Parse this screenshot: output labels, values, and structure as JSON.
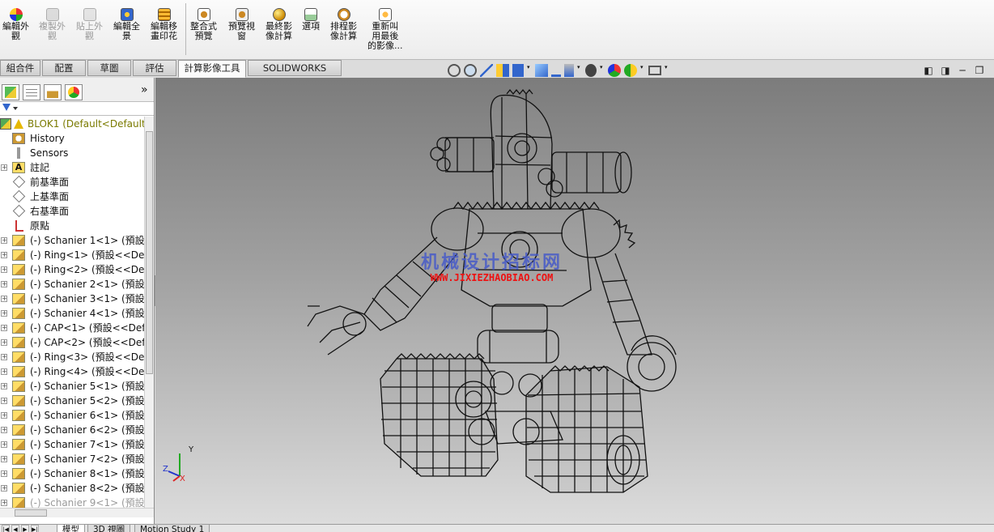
{
  "ribbon": {
    "buttons": [
      {
        "label": "編輯外\n觀",
        "icon": "edit-appearance-icon",
        "enabled": true
      },
      {
        "label": "複製外\n觀",
        "icon": "copy-appearance-icon",
        "enabled": false
      },
      {
        "label": "貼上外\n觀",
        "icon": "paste-appearance-icon",
        "enabled": false
      },
      {
        "label": "編輯全\n景",
        "icon": "edit-scene-icon",
        "enabled": true
      },
      {
        "label": "編輯移\n畫印花",
        "icon": "edit-decal-icon",
        "enabled": true
      },
      {
        "label": "整合式\n預覽",
        "icon": "integrated-preview-icon",
        "enabled": true
      },
      {
        "label": "預覽視\n窗",
        "icon": "preview-window-icon",
        "enabled": true
      },
      {
        "label": "最終影\n像計算",
        "icon": "final-render-icon",
        "enabled": true
      },
      {
        "label": "選項",
        "icon": "options-icon",
        "enabled": true
      },
      {
        "label": "排程影\n像計算",
        "icon": "schedule-render-icon",
        "enabled": true
      },
      {
        "label": "重新叫\n用最後\n的影像...",
        "icon": "recall-last-image-icon",
        "enabled": true
      }
    ]
  },
  "tabs": [
    "組合件",
    "配置",
    "草圖",
    "評估",
    "計算影像工具",
    "SOLIDWORKS MBD"
  ],
  "active_tab": "計算影像工具",
  "panel": {
    "more": "»",
    "filter_icon": "filter-icon"
  },
  "tree": [
    {
      "label": "BLOK1  (Default<Default_",
      "icon": "assembly-icon",
      "expand": "minus",
      "root": true
    },
    {
      "label": "History",
      "icon": "history-icon",
      "expand": ""
    },
    {
      "label": "Sensors",
      "icon": "sensors-icon",
      "expand": ""
    },
    {
      "label": "註記",
      "icon": "annotations-icon",
      "expand": "plus"
    },
    {
      "label": "前基準面",
      "icon": "plane-icon",
      "expand": ""
    },
    {
      "label": "上基準面",
      "icon": "plane-icon",
      "expand": ""
    },
    {
      "label": "右基準面",
      "icon": "plane-icon",
      "expand": ""
    },
    {
      "label": "原點",
      "icon": "origin-icon",
      "expand": ""
    },
    {
      "label": "(-) Schanier 1<1> (預設<",
      "icon": "part-icon",
      "expand": "plus"
    },
    {
      "label": "(-) Ring<1> (預設<<Defa",
      "icon": "part-icon",
      "expand": "plus"
    },
    {
      "label": "(-) Ring<2> (預設<<Defa",
      "icon": "part-icon",
      "expand": "plus"
    },
    {
      "label": "(-) Schanier 2<1> (預設<",
      "icon": "part-icon",
      "expand": "plus"
    },
    {
      "label": "(-) Schanier 3<1> (預設<",
      "icon": "part-icon",
      "expand": "plus"
    },
    {
      "label": "(-) Schanier 4<1> (預設<",
      "icon": "part-icon",
      "expand": "plus"
    },
    {
      "label": "(-) CAP<1> (預設<<Defa",
      "icon": "part-icon",
      "expand": "plus"
    },
    {
      "label": "(-) CAP<2> (預設<<Defa",
      "icon": "part-icon",
      "expand": "plus"
    },
    {
      "label": "(-) Ring<3> (預設<<Defa",
      "icon": "part-icon",
      "expand": "plus"
    },
    {
      "label": "(-) Ring<4> (預設<<Defa",
      "icon": "part-icon",
      "expand": "plus"
    },
    {
      "label": "(-) Schanier 5<1> (預設<",
      "icon": "part-icon",
      "expand": "plus"
    },
    {
      "label": "(-) Schanier 5<2> (預設<",
      "icon": "part-icon",
      "expand": "plus"
    },
    {
      "label": "(-) Schanier 6<1> (預設<",
      "icon": "part-icon",
      "expand": "plus"
    },
    {
      "label": "(-) Schanier 6<2> (預設<",
      "icon": "part-icon",
      "expand": "plus"
    },
    {
      "label": "(-) Schanier 7<1> (預設<",
      "icon": "part-icon",
      "expand": "plus"
    },
    {
      "label": "(-) Schanier 7<2> (預設<",
      "icon": "part-icon",
      "expand": "plus"
    },
    {
      "label": "(-) Schanier 8<1> (預設<",
      "icon": "part-icon",
      "expand": "plus"
    },
    {
      "label": "(-) Schanier 8<2> (預設<",
      "icon": "part-icon",
      "expand": "plus"
    },
    {
      "label": "(-) Schanier 9<1> (預設",
      "icon": "part-icon",
      "expand": "plus",
      "faded": true
    }
  ],
  "watermark": {
    "cn": "机械设计招标网",
    "url": "WWW.JIXIEZHAOBIAO.COM"
  },
  "triad": {
    "x": "X",
    "y": "Y",
    "z": "Z"
  },
  "window_buttons": [
    "◧",
    "◨",
    "─",
    "❐"
  ],
  "bottom_tabs": [
    "模型",
    "3D 視圖",
    "Motion Study 1"
  ],
  "bottom_active": "模型",
  "colors": {
    "viewport_top": "#7c7c7c",
    "viewport_bottom": "#dcdcdc",
    "root_label": "#7a7a00",
    "watermark_url": "#ee1111"
  }
}
